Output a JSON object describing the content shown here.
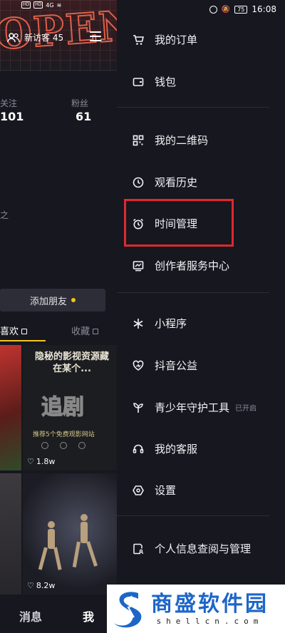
{
  "status_bar": {
    "time": "16:08",
    "battery": "75"
  },
  "profile": {
    "visitors_label": "新访客 45",
    "follow_label": "关注",
    "follow_value": "101",
    "fans_label": "粉丝",
    "fans_value": "61",
    "add_friend_label": "添加朋友",
    "tab_likes": "喜欢",
    "tab_favorites": "收藏"
  },
  "videos": [
    {
      "title": "隐秘的影视资源藏在某个...",
      "caption": "推荐5个免费观影网站",
      "likes": "1.8w"
    },
    {
      "likes": "8.2w"
    }
  ],
  "bottom_nav": {
    "messages": "消息",
    "me": "我"
  },
  "drawer": {
    "items": [
      {
        "label": "我的订单",
        "icon": "cart-icon"
      },
      {
        "label": "钱包",
        "icon": "wallet-icon"
      },
      {
        "label": "我的二维码",
        "icon": "qr-code-icon"
      },
      {
        "label": "观看历史",
        "icon": "clock-icon"
      },
      {
        "label": "时间管理",
        "icon": "alarm-clock-icon"
      },
      {
        "label": "创作者服务中心",
        "icon": "chart-monitor-icon"
      },
      {
        "label": "小程序",
        "icon": "asterisk-icon"
      },
      {
        "label": "抖音公益",
        "icon": "heart-charity-icon"
      },
      {
        "label": "青少年守护工具",
        "icon": "sprout-icon",
        "tag": "已开启"
      },
      {
        "label": "我的客服",
        "icon": "headset-icon"
      },
      {
        "label": "设置",
        "icon": "hexagon-settings-icon"
      },
      {
        "label": "个人信息查阅与管理",
        "icon": "personal-info-icon"
      }
    ]
  },
  "watermark": {
    "text": "商盛软件园",
    "sub": "shellcn.com"
  },
  "colors": {
    "highlight": "#e0282e",
    "accent": "#f5c518",
    "watermark": "#1d66c8"
  }
}
